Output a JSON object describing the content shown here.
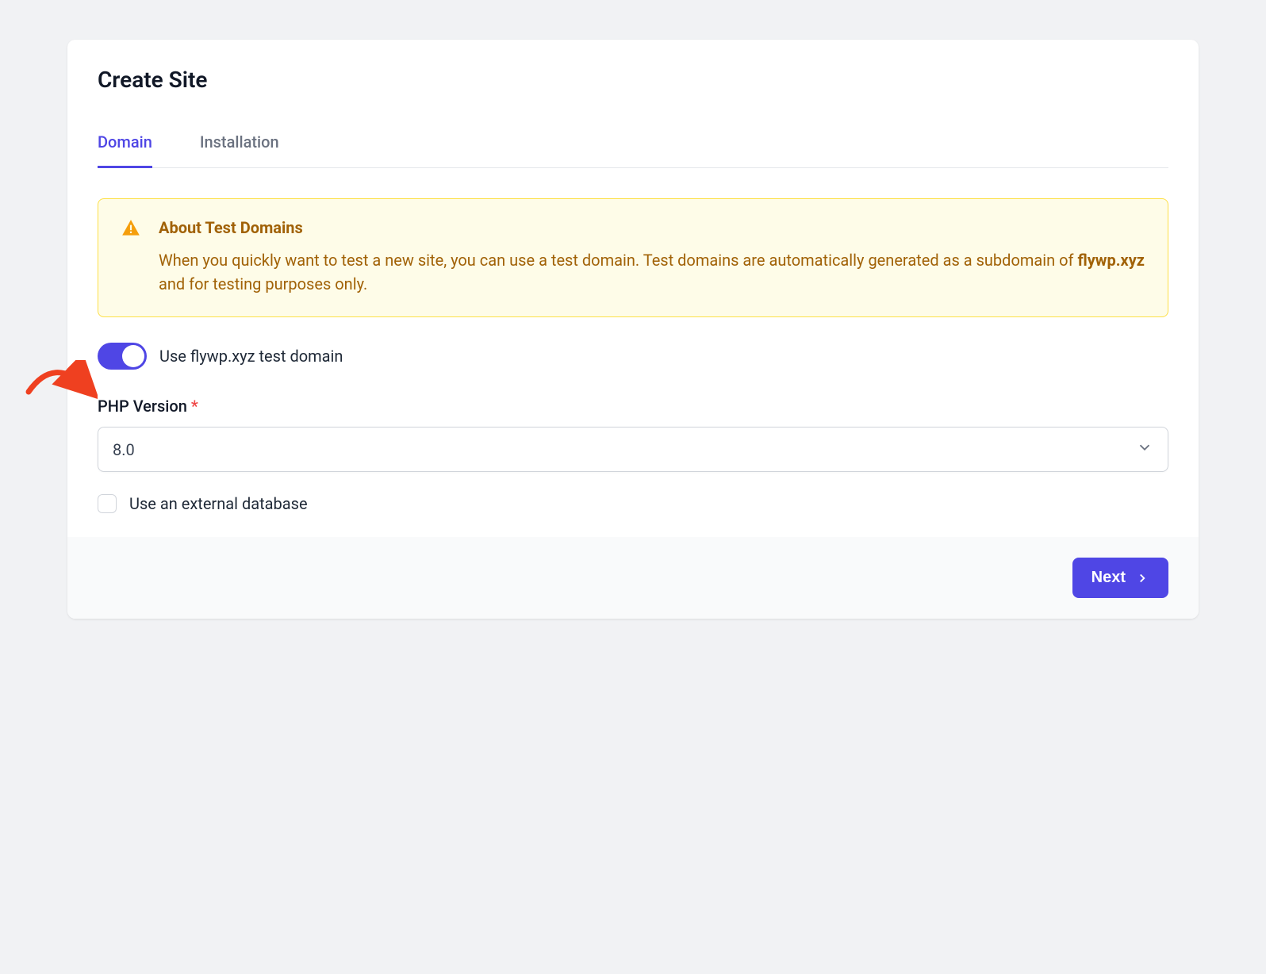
{
  "page": {
    "title": "Create Site"
  },
  "tabs": {
    "domain": "Domain",
    "installation": "Installation"
  },
  "alert": {
    "title": "About Test Domains",
    "text_before": "When you quickly want to test a new site, you can use a test domain. Test domains are automatically generated as a subdomain of ",
    "text_bold": "flywp.xyz",
    "text_after": " and for testing purposes only."
  },
  "toggle": {
    "label": "Use flywp.xyz test domain",
    "enabled": true
  },
  "php": {
    "label": "PHP Version",
    "required": "*",
    "value": "8.0"
  },
  "external_db": {
    "label": "Use an external database",
    "checked": false
  },
  "buttons": {
    "next": "Next"
  }
}
